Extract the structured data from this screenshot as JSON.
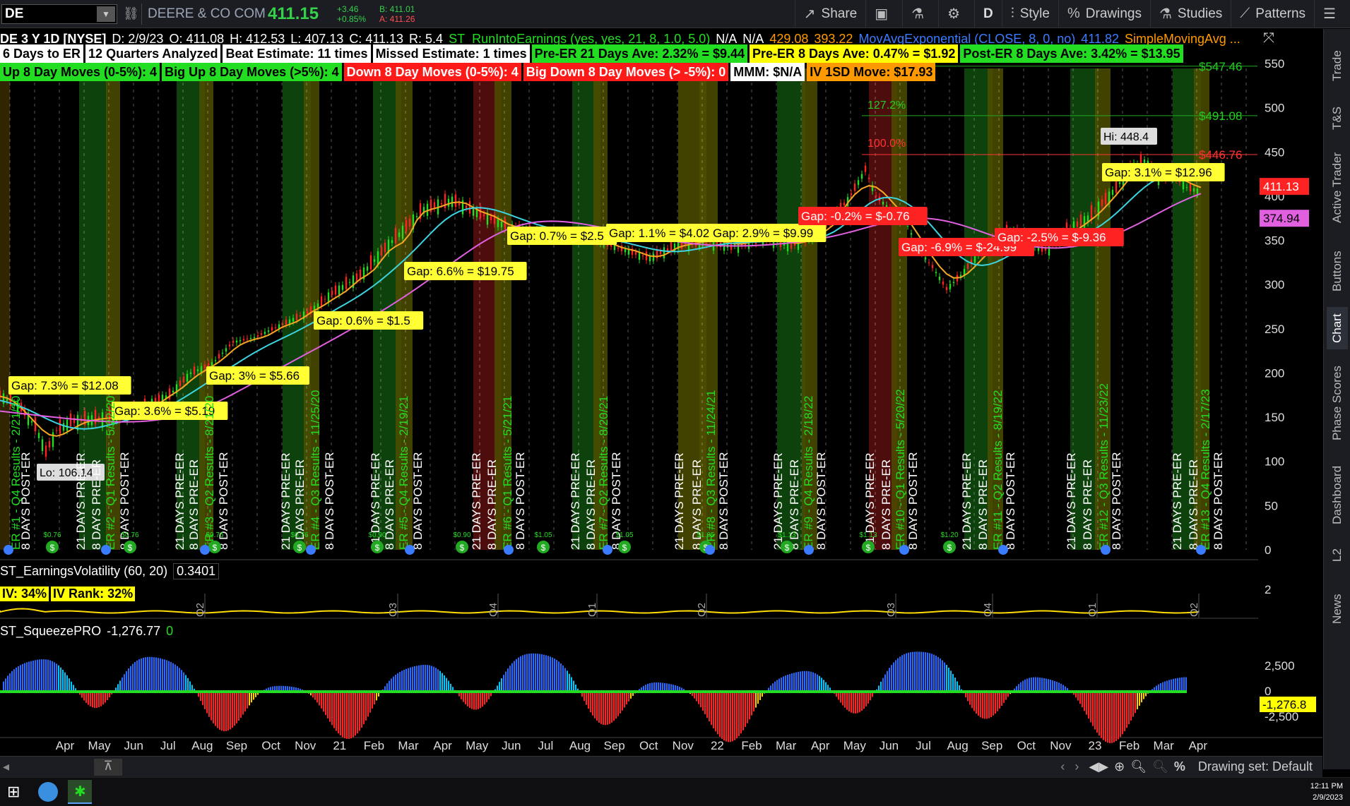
{
  "toolbar": {
    "symbol": "DE",
    "company": "DEERE & CO COM",
    "last": "411.15",
    "change": "+3.46",
    "change_pct": "+0.85%",
    "bid": "B: 411.01",
    "ask": "A: 411.26",
    "share": "Share",
    "style": "Style",
    "drawings": "Drawings",
    "studies": "Studies",
    "patterns": "Patterns",
    "aggregation": "D"
  },
  "chart_info": {
    "title": "DE 3 Y 1D [NYSE]",
    "date": "D: 2/9/23",
    "open": "O: 411.08",
    "high": "H: 412.53",
    "low": "L: 407.13",
    "close": "C: 411.13",
    "range": "R: 5.4",
    "study1": "ST_RunIntoEarnings (yes, yes, 21, 8, 1.0, 5.0)",
    "na1": "N/A",
    "na2": "N/A",
    "v1": "429.08",
    "v2": "393.22",
    "study2": "MovAvgExponential (CLOSE, 8, 0, no)",
    "v3": "411.82",
    "study3": "SimpleMovingAvg ..."
  },
  "badges_row1": [
    {
      "text": "6 Days to ER",
      "bg": "#ffffff",
      "fg": "#000000"
    },
    {
      "text": "12 Quarters Analyzed",
      "bg": "#ffffff",
      "fg": "#000000"
    },
    {
      "text": "Beat Estimate: 11 times",
      "bg": "#ffffff",
      "fg": "#000000"
    },
    {
      "text": "Missed Estimate: 1 times",
      "bg": "#ffffff",
      "fg": "#000000"
    },
    {
      "text": "Pre-ER 21 Days Ave: 2.32% = $9.44",
      "bg": "#22dd22",
      "fg": "#000000"
    },
    {
      "text": "Pre-ER 8 Days Ave: 0.47% = $1.92",
      "bg": "#ffff00",
      "fg": "#000000"
    },
    {
      "text": "Post-ER 8 Days Ave: 3.42% = $13.95",
      "bg": "#22dd22",
      "fg": "#000000"
    }
  ],
  "badges_row2": [
    {
      "text": "Up 8 Day Moves (0-5%): 4",
      "bg": "#22dd22",
      "fg": "#000000"
    },
    {
      "text": "Big Up 8 Day Moves (>5%): 4",
      "bg": "#22dd22",
      "fg": "#000000"
    },
    {
      "text": "Down 8 Day Moves (0-5%): 4",
      "bg": "#ff1a1a",
      "fg": "#ffffff"
    },
    {
      "text": "Big Down 8 Day Moves (> -5%): 0",
      "bg": "#ff1a1a",
      "fg": "#ffffff"
    },
    {
      "text": "MMM: $N/A",
      "bg": "#ffffff",
      "fg": "#000000"
    },
    {
      "text": "IV 1SD Move: $17.93",
      "bg": "#ff9900",
      "fg": "#000000"
    }
  ],
  "price_axis": {
    "ticks": [
      "550",
      "500",
      "450",
      "400",
      "350",
      "300",
      "250",
      "200",
      "150",
      "100",
      "50",
      "0"
    ],
    "last_price_label": "411.13",
    "sma_label": "374.94",
    "fib_labels": [
      {
        "text": "$547.46",
        "color": "#22cc22"
      },
      {
        "text": "$491.08",
        "color": "#22cc22"
      },
      {
        "text": "$446.76",
        "color": "#ff3333"
      }
    ],
    "fib_pct": [
      {
        "text": "127.2%",
        "color": "#22cc22"
      },
      {
        "text": "100.0%",
        "color": "#ff3333"
      }
    ],
    "hi_label": "Hi: 448.4",
    "lo_label": "Lo: 106.14"
  },
  "gaps": [
    {
      "text": "Gap: 7.3% = $12.08",
      "type": "up"
    },
    {
      "text": "Gap: 3.6% = $5.19",
      "type": "up"
    },
    {
      "text": "Gap: 3% = $5.66",
      "type": "up"
    },
    {
      "text": "Gap: 0.6% = $1.5",
      "type": "up"
    },
    {
      "text": "Gap: 6.6% = $19.75",
      "type": "up"
    },
    {
      "text": "Gap: 0.7% = $2.5",
      "type": "up"
    },
    {
      "text": "Gap: 1.1% = $4.02",
      "type": "up"
    },
    {
      "text": "Gap: 2.9% = $9.99",
      "type": "up"
    },
    {
      "text": "Gap: -0.2% = $-0.76",
      "type": "down"
    },
    {
      "text": "Gap: -6.9% = $-24.99",
      "type": "down"
    },
    {
      "text": "Gap: -2.5% = $-9.36",
      "type": "down"
    },
    {
      "text": "Gap: 3.1% = $12.96",
      "type": "up"
    }
  ],
  "er_labels": [
    "ER #1 - Q4 Results - 2/21/20",
    "ER #2 - Q1 Results - 5/22/20",
    "ER #3 - Q2 Results - 8/21/20",
    "ER #4 - Q3 Results - 11/25/20",
    "ER #5 - Q4 Results - 2/19/21",
    "ER #6 - Q1 Results - 5/21/21",
    "ER #7 - Q2 Results - 8/20/21",
    "ER #8 - Q3 Results - 11/24/21",
    "ER #9 - Q4 Results - 2/18/22",
    "ER #10 - Q1 Results - 5/20/22",
    "ER #11 - Q2 Results - 8/19/22",
    "ER #12 - Q3 Results - 11/23/22",
    "ER #13 - Q4 Results - 2/17/23"
  ],
  "window_labels": {
    "pre21": "21 DAYS PRE-ER",
    "pre8": "8 DAYS PRE-ER",
    "post8": "8 DAYS POST-ER"
  },
  "dividends": [
    "$0.76",
    "$0.76",
    "$0.76",
    "$0.76",
    "$0.90",
    "$0.90",
    "$1.05",
    "$1.05",
    "$1.05",
    "$1.13",
    "$1.13",
    "$1.20"
  ],
  "vol_panel": {
    "title": "ST_EarningsVolatility (60, 20)",
    "value": "0.3401",
    "iv": "IV: 34%",
    "iv_rank": "IV Rank: 32%",
    "axis": "2",
    "quarters": [
      "Q2",
      "Q3",
      "Q4",
      "Q1",
      "Q2",
      "Q3",
      "Q4",
      "Q1",
      "Q2",
      "Q3",
      "Q4"
    ]
  },
  "squeeze_panel": {
    "title": "ST_SqueezePRO",
    "value": "-1,276.77",
    "value2": "0",
    "axis": [
      "2,500",
      "0",
      "-2,500"
    ],
    "last_label": "-1,276.8"
  },
  "x_axis": [
    "Apr",
    "May",
    "Jun",
    "Jul",
    "Aug",
    "Sep",
    "Oct",
    "Nov",
    "21",
    "Feb",
    "Mar",
    "Apr",
    "May",
    "Jun",
    "Jul",
    "Aug",
    "Sep",
    "Oct",
    "Nov",
    "22",
    "Feb",
    "Mar",
    "Apr",
    "May",
    "Jun",
    "Jul",
    "Aug",
    "Sep",
    "Oct",
    "Nov",
    "23",
    "Feb",
    "Mar",
    "Apr"
  ],
  "side_tabs": [
    "Trade",
    "T&S",
    "Active Trader",
    "Buttons",
    "Chart",
    "Phase Scores",
    "Dashboard",
    "L2",
    "News"
  ],
  "bottom_bar": {
    "drawing_set": "Drawing set: Default"
  },
  "clock": {
    "time": "12:11 PM",
    "date": "2/9/2023"
  },
  "colors": {
    "candle_up": "#22dd22",
    "candle_down": "#ff2222",
    "ema8": "#f5a623",
    "ema_cyan": "#3cd4e0",
    "sma_magenta": "#e060e0",
    "zone_green": "#0f4d0f",
    "zone_yellow": "#5a5a00",
    "zone_red": "#5a0f0f"
  }
}
